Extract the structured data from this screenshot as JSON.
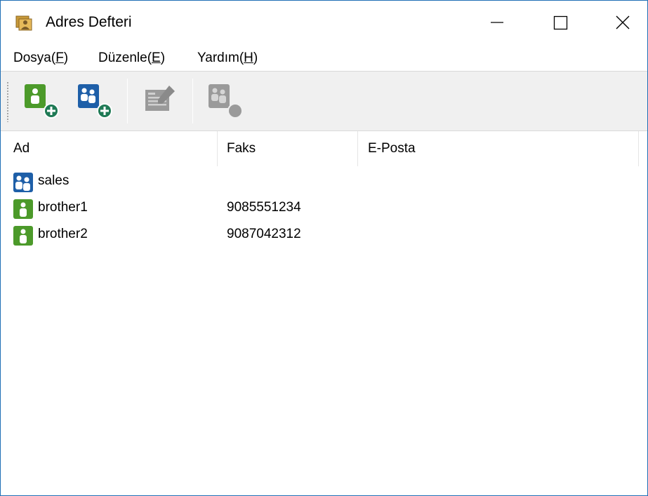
{
  "window": {
    "title": "Adres Defteri",
    "icon": "address-book-icon"
  },
  "controls": {
    "minimize": "minimize-icon",
    "maximize": "maximize-icon",
    "close": "close-icon"
  },
  "menu": {
    "items": [
      {
        "pre": "Dosya(",
        "acc": "F",
        "post": ")"
      },
      {
        "pre": "Düzenle(",
        "acc": "E",
        "post": ")"
      },
      {
        "pre": "Yardım(",
        "acc": "H",
        "post": ")"
      }
    ]
  },
  "toolbar": {
    "buttons": [
      {
        "icon": "add-contact-icon",
        "enabled": true
      },
      {
        "icon": "add-group-icon",
        "enabled": true
      },
      {
        "icon": "edit-icon",
        "enabled": false
      },
      {
        "icon": "delete-icon",
        "enabled": false
      }
    ]
  },
  "list": {
    "columns": [
      "Ad",
      "Faks",
      "E-Posta"
    ],
    "rows": [
      {
        "type": "group",
        "icon": "group-icon",
        "name": "sales",
        "fax": "",
        "email": ""
      },
      {
        "type": "contact",
        "icon": "contact-icon",
        "name": "brother1",
        "fax": "9085551234",
        "email": ""
      },
      {
        "type": "contact",
        "icon": "contact-icon",
        "name": "brother2",
        "fax": "9087042312",
        "email": ""
      }
    ]
  },
  "colors": {
    "contact_green": "#4c9a2a",
    "group_blue": "#1e5fa8",
    "disabled_gray": "#9a9a9a",
    "window_border": "#1f6fb5"
  }
}
